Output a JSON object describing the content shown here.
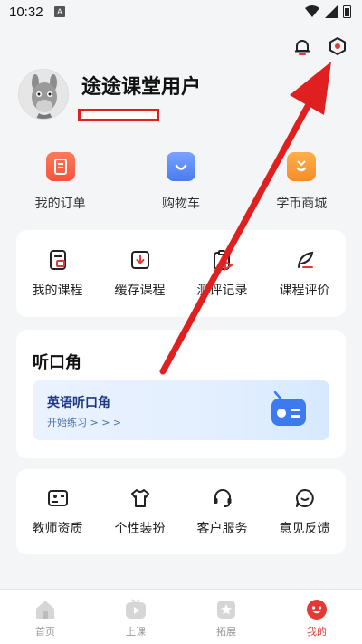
{
  "status_bar": {
    "time": "10:32",
    "notice_letter": "A"
  },
  "header": {
    "username": "途途课堂用户"
  },
  "quick_actions": [
    {
      "label": "我的订单",
      "icon": "order-icon",
      "color": "#f2553d"
    },
    {
      "label": "购物车",
      "icon": "cart-icon",
      "color": "#4a7cf0"
    },
    {
      "label": "学币商城",
      "icon": "mall-icon",
      "color": "#f58c2a"
    }
  ],
  "study_grid": [
    {
      "label": "我的课程",
      "icon": "course-icon"
    },
    {
      "label": "缓存课程",
      "icon": "download-icon"
    },
    {
      "label": "测评记录",
      "icon": "clipboard-icon"
    },
    {
      "label": "课程评价",
      "icon": "feather-icon"
    }
  ],
  "listening": {
    "title": "听口角",
    "banner_title": "英语听口角",
    "banner_sub": "开始练习 > > >"
  },
  "service_grid": [
    {
      "label": "教师资质",
      "icon": "id-card-icon"
    },
    {
      "label": "个性装扮",
      "icon": "shirt-icon"
    },
    {
      "label": "客户服务",
      "icon": "headset-icon"
    },
    {
      "label": "意见反馈",
      "icon": "feedback-icon"
    }
  ],
  "bottom_nav": [
    {
      "label": "首页",
      "icon": "home-icon",
      "active": false
    },
    {
      "label": "上课",
      "icon": "play-icon",
      "active": false
    },
    {
      "label": "拓展",
      "icon": "explore-icon",
      "active": false
    },
    {
      "label": "我的",
      "icon": "profile-icon",
      "active": true
    }
  ],
  "colors": {
    "accent": "#e53935",
    "annotation": "#e02020"
  }
}
